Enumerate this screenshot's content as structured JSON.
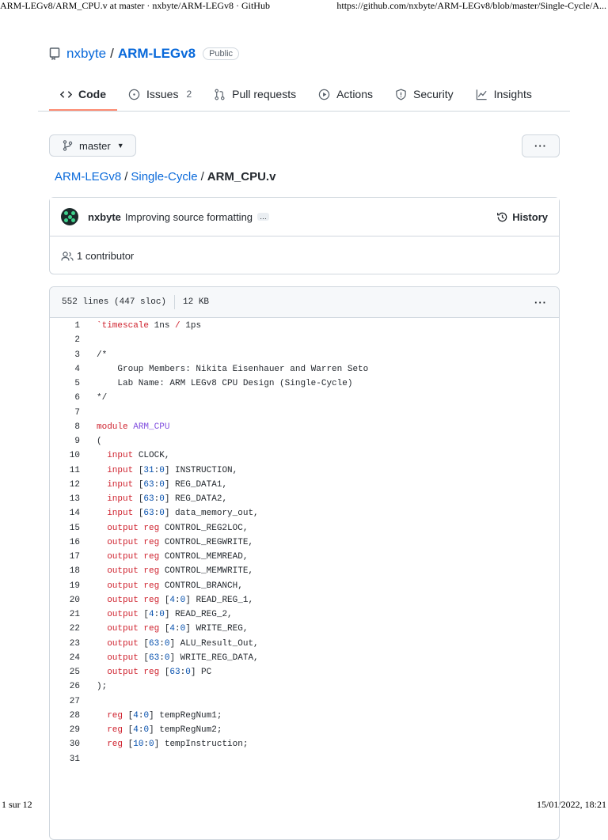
{
  "print_header": {
    "title": "ARM-LEGv8/ARM_CPU.v at master · nxbyte/ARM-LEGv8 · GitHub",
    "url": "https://github.com/nxbyte/ARM-LEGv8/blob/master/Single-Cycle/A..."
  },
  "print_footer": {
    "page": "1 sur 12",
    "datetime": "15/01/2022, 18:21"
  },
  "repo": {
    "owner": "nxbyte",
    "separator": "/",
    "name": "ARM-LEGv8",
    "visibility": "Public",
    "icon": "repo-book-icon"
  },
  "tabs": [
    {
      "label": "Code",
      "icon": "code-icon",
      "active": true
    },
    {
      "label": "Issues",
      "icon": "issue-icon",
      "counter": "2"
    },
    {
      "label": "Pull requests",
      "icon": "pull-request-icon"
    },
    {
      "label": "Actions",
      "icon": "play-icon"
    },
    {
      "label": "Security",
      "icon": "shield-icon"
    },
    {
      "label": "Insights",
      "icon": "graph-icon"
    }
  ],
  "branch": {
    "label": "master",
    "icon": "git-branch-icon"
  },
  "more_menu": "···",
  "breadcrumb": {
    "root": "ARM-LEGv8",
    "folder": "Single-Cycle",
    "separator": "/",
    "file": "ARM_CPU.v"
  },
  "commit": {
    "author": "nxbyte",
    "message": "Improving source formatting",
    "ellipsis": "…",
    "history_label": "History"
  },
  "contributors": {
    "label": "1 contributor"
  },
  "file_info": {
    "lines": "552 lines (447 sloc)",
    "size": "12 KB"
  },
  "colors": {
    "link": "#0969da",
    "keyword": "#cf222e",
    "number": "#0550ae",
    "entity": "#8250df",
    "active_tab_underline": "#fd8c73"
  },
  "code_lines": [
    {
      "n": "1",
      "parts": [
        [
          "kw",
          "`timescale"
        ],
        [
          "",
          " 1ns "
        ],
        [
          "kw",
          "/"
        ],
        [
          "",
          " 1ps"
        ]
      ]
    },
    {
      "n": "2",
      "parts": []
    },
    {
      "n": "3",
      "parts": [
        [
          "",
          "/*"
        ]
      ]
    },
    {
      "n": "4",
      "parts": [
        [
          "",
          "    Group Members: Nikita Eisenhauer and Warren Seto"
        ]
      ]
    },
    {
      "n": "5",
      "parts": [
        [
          "",
          "    Lab Name: ARM LEGv8 CPU Design (Single-Cycle)"
        ]
      ]
    },
    {
      "n": "6",
      "parts": [
        [
          "",
          "*/"
        ]
      ]
    },
    {
      "n": "7",
      "parts": []
    },
    {
      "n": "8",
      "parts": [
        [
          "kw",
          "module"
        ],
        [
          "",
          " "
        ],
        [
          "ent",
          "ARM_CPU"
        ]
      ]
    },
    {
      "n": "9",
      "parts": [
        [
          "",
          "("
        ]
      ]
    },
    {
      "n": "10",
      "parts": [
        [
          "",
          "  "
        ],
        [
          "kw",
          "input"
        ],
        [
          "",
          " CLOCK,"
        ]
      ]
    },
    {
      "n": "11",
      "parts": [
        [
          "",
          "  "
        ],
        [
          "kw",
          "input"
        ],
        [
          "",
          " ["
        ],
        [
          "nm",
          "31"
        ],
        [
          "",
          ":"
        ],
        [
          "nm",
          "0"
        ],
        [
          "",
          "] INSTRUCTION,"
        ]
      ]
    },
    {
      "n": "12",
      "parts": [
        [
          "",
          "  "
        ],
        [
          "kw",
          "input"
        ],
        [
          "",
          " ["
        ],
        [
          "nm",
          "63"
        ],
        [
          "",
          ":"
        ],
        [
          "nm",
          "0"
        ],
        [
          "",
          "] REG_DATA1,"
        ]
      ]
    },
    {
      "n": "13",
      "parts": [
        [
          "",
          "  "
        ],
        [
          "kw",
          "input"
        ],
        [
          "",
          " ["
        ],
        [
          "nm",
          "63"
        ],
        [
          "",
          ":"
        ],
        [
          "nm",
          "0"
        ],
        [
          "",
          "] REG_DATA2,"
        ]
      ]
    },
    {
      "n": "14",
      "parts": [
        [
          "",
          "  "
        ],
        [
          "kw",
          "input"
        ],
        [
          "",
          " ["
        ],
        [
          "nm",
          "63"
        ],
        [
          "",
          ":"
        ],
        [
          "nm",
          "0"
        ],
        [
          "",
          "] data_memory_out,"
        ]
      ]
    },
    {
      "n": "15",
      "parts": [
        [
          "",
          "  "
        ],
        [
          "kw",
          "output reg"
        ],
        [
          "",
          " CONTROL_REG2LOC,"
        ]
      ]
    },
    {
      "n": "16",
      "parts": [
        [
          "",
          "  "
        ],
        [
          "kw",
          "output reg"
        ],
        [
          "",
          " CONTROL_REGWRITE,"
        ]
      ]
    },
    {
      "n": "17",
      "parts": [
        [
          "",
          "  "
        ],
        [
          "kw",
          "output reg"
        ],
        [
          "",
          " CONTROL_MEMREAD,"
        ]
      ]
    },
    {
      "n": "18",
      "parts": [
        [
          "",
          "  "
        ],
        [
          "kw",
          "output reg"
        ],
        [
          "",
          " CONTROL_MEMWRITE,"
        ]
      ]
    },
    {
      "n": "19",
      "parts": [
        [
          "",
          "  "
        ],
        [
          "kw",
          "output reg"
        ],
        [
          "",
          " CONTROL_BRANCH,"
        ]
      ]
    },
    {
      "n": "20",
      "parts": [
        [
          "",
          "  "
        ],
        [
          "kw",
          "output reg"
        ],
        [
          "",
          " ["
        ],
        [
          "nm",
          "4"
        ],
        [
          "",
          ":"
        ],
        [
          "nm",
          "0"
        ],
        [
          "",
          "] READ_REG_1,"
        ]
      ]
    },
    {
      "n": "21",
      "parts": [
        [
          "",
          "  "
        ],
        [
          "kw",
          "output"
        ],
        [
          "",
          " ["
        ],
        [
          "nm",
          "4"
        ],
        [
          "",
          ":"
        ],
        [
          "nm",
          "0"
        ],
        [
          "",
          "] READ_REG_2,"
        ]
      ]
    },
    {
      "n": "22",
      "parts": [
        [
          "",
          "  "
        ],
        [
          "kw",
          "output reg"
        ],
        [
          "",
          " ["
        ],
        [
          "nm",
          "4"
        ],
        [
          "",
          ":"
        ],
        [
          "nm",
          "0"
        ],
        [
          "",
          "] WRITE_REG,"
        ]
      ]
    },
    {
      "n": "23",
      "parts": [
        [
          "",
          "  "
        ],
        [
          "kw",
          "output"
        ],
        [
          "",
          " ["
        ],
        [
          "nm",
          "63"
        ],
        [
          "",
          ":"
        ],
        [
          "nm",
          "0"
        ],
        [
          "",
          "] ALU_Result_Out,"
        ]
      ]
    },
    {
      "n": "24",
      "parts": [
        [
          "",
          "  "
        ],
        [
          "kw",
          "output"
        ],
        [
          "",
          " ["
        ],
        [
          "nm",
          "63"
        ],
        [
          "",
          ":"
        ],
        [
          "nm",
          "0"
        ],
        [
          "",
          "] WRITE_REG_DATA,"
        ]
      ]
    },
    {
      "n": "25",
      "parts": [
        [
          "",
          "  "
        ],
        [
          "kw",
          "output reg"
        ],
        [
          "",
          " ["
        ],
        [
          "nm",
          "63"
        ],
        [
          "",
          ":"
        ],
        [
          "nm",
          "0"
        ],
        [
          "",
          "] PC"
        ]
      ]
    },
    {
      "n": "26",
      "parts": [
        [
          "",
          ");"
        ]
      ]
    },
    {
      "n": "27",
      "parts": []
    },
    {
      "n": "28",
      "parts": [
        [
          "",
          "  "
        ],
        [
          "kw",
          "reg"
        ],
        [
          "",
          " ["
        ],
        [
          "nm",
          "4"
        ],
        [
          "",
          ":"
        ],
        [
          "nm",
          "0"
        ],
        [
          "",
          "] tempRegNum1;"
        ]
      ]
    },
    {
      "n": "29",
      "parts": [
        [
          "",
          "  "
        ],
        [
          "kw",
          "reg"
        ],
        [
          "",
          " ["
        ],
        [
          "nm",
          "4"
        ],
        [
          "",
          ":"
        ],
        [
          "nm",
          "0"
        ],
        [
          "",
          "] tempRegNum2;"
        ]
      ]
    },
    {
      "n": "30",
      "parts": [
        [
          "",
          "  "
        ],
        [
          "kw",
          "reg"
        ],
        [
          "",
          " ["
        ],
        [
          "nm",
          "10"
        ],
        [
          "",
          ":"
        ],
        [
          "nm",
          "0"
        ],
        [
          "",
          "] tempInstruction;"
        ]
      ]
    },
    {
      "n": "31",
      "parts": []
    }
  ]
}
